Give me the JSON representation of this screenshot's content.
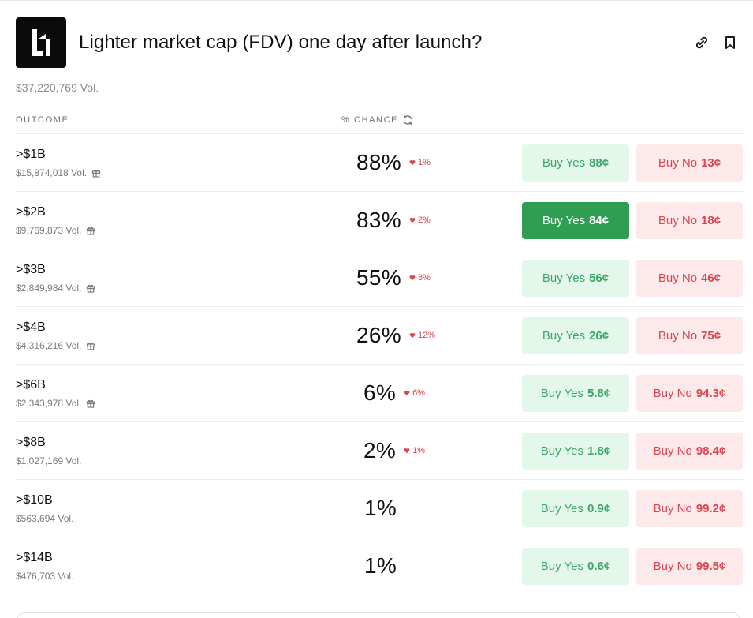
{
  "market": {
    "title": "Lighter market cap (FDV) one day after launch?",
    "volume": "$37,220,769 Vol.",
    "logo": "lighter-logo",
    "icons": {
      "link": "link-icon",
      "bookmark": "bookmark-icon",
      "refresh": "refresh-icon",
      "gift": "gift-icon",
      "heart": "heart-icon"
    }
  },
  "columns": {
    "outcome": "OUTCOME",
    "chance": "% CHANCE"
  },
  "colors": {
    "yes_text": "#3da56a",
    "yes_bg": "#e3f7ea",
    "yes_active_bg": "#2f9e52",
    "no_text": "#d9464f",
    "no_bg": "#fde8ea",
    "delta": "#d4484f"
  },
  "outcomes": [
    {
      "label": ">$1B",
      "volume": "$15,874,018 Vol.",
      "gift": true,
      "chance": "88%",
      "delta": "1%",
      "yes_label": "Buy Yes",
      "yes_price": "88¢",
      "no_label": "Buy No",
      "no_price": "13¢",
      "yes_active": false
    },
    {
      "label": ">$2B",
      "volume": "$9,769,873 Vol.",
      "gift": true,
      "chance": "83%",
      "delta": "2%",
      "yes_label": "Buy Yes",
      "yes_price": "84¢",
      "no_label": "Buy No",
      "no_price": "18¢",
      "yes_active": true
    },
    {
      "label": ">$3B",
      "volume": "$2,849,984 Vol.",
      "gift": true,
      "chance": "55%",
      "delta": "8%",
      "yes_label": "Buy Yes",
      "yes_price": "56¢",
      "no_label": "Buy No",
      "no_price": "46¢",
      "yes_active": false
    },
    {
      "label": ">$4B",
      "volume": "$4,316,216 Vol.",
      "gift": true,
      "chance": "26%",
      "delta": "12%",
      "yes_label": "Buy Yes",
      "yes_price": "26¢",
      "no_label": "Buy No",
      "no_price": "75¢",
      "yes_active": false
    },
    {
      "label": ">$6B",
      "volume": "$2,343,978 Vol.",
      "gift": true,
      "chance": "6%",
      "delta": "6%",
      "yes_label": "Buy Yes",
      "yes_price": "5.8¢",
      "no_label": "Buy No",
      "no_price": "94.3¢",
      "yes_active": false
    },
    {
      "label": ">$8B",
      "volume": "$1,027,169 Vol.",
      "gift": false,
      "chance": "2%",
      "delta": "1%",
      "yes_label": "Buy Yes",
      "yes_price": "1.8¢",
      "no_label": "Buy No",
      "no_price": "98.4¢",
      "yes_active": false
    },
    {
      "label": ">$10B",
      "volume": "$563,694 Vol.",
      "gift": false,
      "chance": "1%",
      "delta": "",
      "yes_label": "Buy Yes",
      "yes_price": "0.9¢",
      "no_label": "Buy No",
      "no_price": "99.2¢",
      "yes_active": false
    },
    {
      "label": ">$14B",
      "volume": "$476,703 Vol.",
      "gift": false,
      "chance": "1%",
      "delta": "",
      "yes_label": "Buy Yes",
      "yes_price": "0.6¢",
      "no_label": "Buy No",
      "no_price": "99.5¢",
      "yes_active": false
    }
  ]
}
